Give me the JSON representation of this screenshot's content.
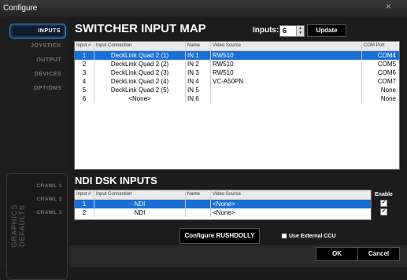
{
  "window": {
    "title": "Configure",
    "close_glyph": "×"
  },
  "sidebar": {
    "items": [
      {
        "label": "INPUTS",
        "active": true
      },
      {
        "label": "JOYSTICK",
        "active": false
      },
      {
        "label": "OUTPUT",
        "active": false
      },
      {
        "label": "DEVICES",
        "active": false
      },
      {
        "label": "OPTIONS",
        "active": false
      }
    ],
    "graphics_defaults": {
      "label": "GRAPHICS DEFAULTS",
      "items": [
        "CRAWL 1",
        "CRAWL 2",
        "CRAWL 3"
      ]
    }
  },
  "switcher": {
    "title": "SWITCHER INPUT MAP",
    "inputs_label": "Inputs:",
    "inputs_value": "6",
    "update_label": "Update",
    "columns": [
      "Input #",
      "Input Connection",
      "Name",
      "Video Source",
      "COM Port"
    ],
    "rows": [
      {
        "num": "1",
        "conn": "DeckLink Quad 2 (1)",
        "name": "IN 1",
        "source": "RW510",
        "com": "COM4",
        "selected": true
      },
      {
        "num": "2",
        "conn": "DeckLink Quad 2 (2)",
        "name": "IN 2",
        "source": "RW510",
        "com": "COM5",
        "selected": false
      },
      {
        "num": "3",
        "conn": "DeckLink Quad 2 (3)",
        "name": "IN 3",
        "source": "RW510",
        "com": "COM6",
        "selected": false
      },
      {
        "num": "4",
        "conn": "DeckLink Quad 2 (4)",
        "name": "IN 4",
        "source": "VC-A50PN",
        "com": "COM7",
        "selected": false
      },
      {
        "num": "5",
        "conn": "DeckLink Quad 2 (5)",
        "name": "IN 5",
        "source": "",
        "com": "None",
        "selected": false
      },
      {
        "num": "6",
        "conn": "<None>",
        "name": "IN 6",
        "source": "",
        "com": "None",
        "selected": false
      }
    ]
  },
  "ndi": {
    "title": "NDI DSK INPUTS",
    "enable_label": "Enable",
    "columns": [
      "Input #",
      "Input Connection",
      "Name",
      "Video Source"
    ],
    "rows": [
      {
        "num": "1",
        "conn": "NDI",
        "name": "",
        "source": "<None>",
        "selected": true,
        "enabled": true
      },
      {
        "num": "2",
        "conn": "NDI",
        "name": "",
        "source": "<None>",
        "selected": false,
        "enabled": true
      }
    ]
  },
  "configure_label": "Configure RUSHDOLLY",
  "external_ccu": {
    "label": "Use External CCU",
    "checked": false
  },
  "check_glyph": "✔",
  "spin_glyphs": {
    "up": "▲",
    "down": "▼"
  },
  "footer": {
    "ok_label": "OK",
    "cancel_label": "Cancel"
  },
  "colors": {
    "accent": "#1a6fd6",
    "nav_border": "#3b8bd9",
    "background": "#1b1b1b"
  }
}
